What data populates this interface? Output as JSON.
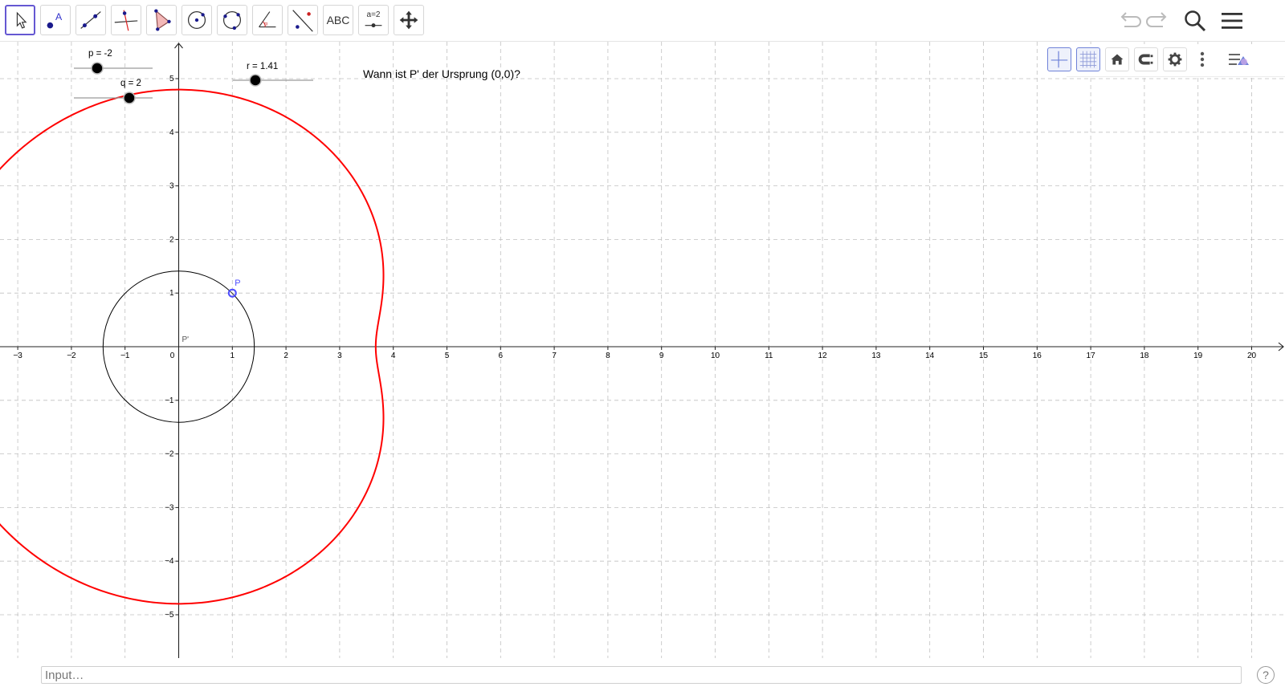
{
  "toolbar": {
    "tools": [
      {
        "name": "move-tool",
        "label": ""
      },
      {
        "name": "point-tool",
        "label": ""
      },
      {
        "name": "line-tool",
        "label": ""
      },
      {
        "name": "perpendicular-tool",
        "label": ""
      },
      {
        "name": "polygon-tool",
        "label": ""
      },
      {
        "name": "circle-center-tool",
        "label": ""
      },
      {
        "name": "circle-three-points-tool",
        "label": ""
      },
      {
        "name": "angle-tool",
        "label": ""
      },
      {
        "name": "reflect-tool",
        "label": ""
      },
      {
        "name": "text-tool",
        "label": "ABC"
      },
      {
        "name": "slider-tool",
        "label": "a=2"
      },
      {
        "name": "move-graphics-tool",
        "label": ""
      }
    ],
    "active_tool": "move-tool",
    "right_icons": [
      "undo-icon",
      "redo-icon",
      "search-icon",
      "menu-icon"
    ]
  },
  "style_bar": {
    "icons": [
      "axes-toggle-icon",
      "grid-toggle-icon",
      "home-icon",
      "point-capturing-icon",
      "settings-gear-icon",
      "more-dots-icon",
      "view-menu-icon"
    ],
    "axes_on": true,
    "grid_on": true
  },
  "sliders": {
    "p": {
      "label": "p = -2",
      "value": -2
    },
    "q": {
      "label": "q = 2",
      "value": 2
    },
    "r": {
      "label": "r = 1.41",
      "value": 1.41
    }
  },
  "question_text": "Wann ist P' der Ursprung (0,0)?",
  "axes": {
    "x_ticks": [
      "−3",
      "−2",
      "−1",
      "0",
      "1",
      "2",
      "3",
      "4",
      "5",
      "6",
      "7",
      "8",
      "9",
      "10",
      "11",
      "12",
      "13",
      "14",
      "15",
      "16",
      "17",
      "18",
      "19",
      "20"
    ],
    "y_ticks": [
      "5",
      "4",
      "3",
      "2",
      "1",
      "−1",
      "−2",
      "−3",
      "−4",
      "−5"
    ],
    "x_range": [
      -3.3,
      20.6
    ],
    "y_range": [
      -5.6,
      5.8
    ],
    "grid": true
  },
  "objects": {
    "point_P": {
      "label": "P",
      "x": 1,
      "y": 1
    },
    "point_P_image": {
      "label": "P'",
      "x": 0,
      "y": 0
    },
    "circle": {
      "center": [
        0,
        0
      ],
      "radius": 1.41,
      "color": "#000000"
    },
    "locus": {
      "color": "#ff0000"
    }
  },
  "input_bar": {
    "placeholder": "Input…"
  },
  "help_label": "?",
  "colors": {
    "accent": "#6557d2",
    "curve": "#ff0000",
    "point": "#4d4dff",
    "grid": "#c0c0c0"
  }
}
